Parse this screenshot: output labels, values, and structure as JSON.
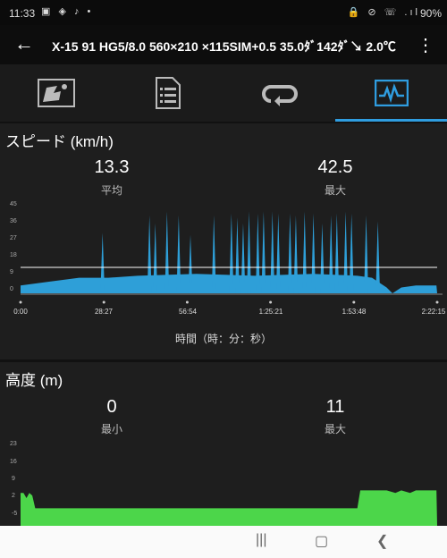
{
  "status": {
    "time": "11:33",
    "left_icons": "▣ ◈ ♪ •",
    "right_icons": "🔒 ⊘ ☏ .ıl",
    "battery": "90%"
  },
  "appbar": {
    "title": "X-15 91 HG5/8.0 560×210 ×115SIM+0.5 35.0ﾀﾞ142ﾀﾞ↘ 2.0℃"
  },
  "tabs": [
    {
      "name": "tab-map",
      "icon": "map-icon"
    },
    {
      "name": "tab-details",
      "icon": "document-icon"
    },
    {
      "name": "tab-laps",
      "icon": "loop-icon"
    },
    {
      "name": "tab-graphs",
      "icon": "graph-icon",
      "active": true
    }
  ],
  "speed": {
    "header": "スピード (km/h)",
    "avg_value": "13.3",
    "avg_label": "平均",
    "max_value": "42.5",
    "max_label": "最大",
    "y_ticks": [
      "45",
      "36",
      "27",
      "18",
      "9",
      "0"
    ],
    "x_ticks": [
      "0:00",
      "28:27",
      "56:54",
      "1:25:21",
      "1:53:48",
      "2:22:15"
    ],
    "x_axis_title": "時間（時：分：秒）",
    "line_color": "#2e9fd8"
  },
  "elevation": {
    "header": "高度 (m)",
    "min_value": "0",
    "min_label": "最小",
    "max_value": "11",
    "max_label": "最大",
    "y_ticks": [
      "23",
      "16",
      "9",
      "2",
      "-5"
    ],
    "fill_color": "#4cd64a"
  },
  "chart_data": [
    {
      "type": "area",
      "ylabel": "スピード (km/h)",
      "xlabel": "時間（時：分：秒）",
      "ylim": [
        0,
        45
      ],
      "x_range_minutes": [
        0,
        142.25
      ],
      "average": 13.3,
      "peaks_minutes": [
        [
          28,
          31
        ],
        [
          44,
          40
        ],
        [
          46,
          36
        ],
        [
          50,
          42
        ],
        [
          54,
          40
        ],
        [
          58,
          30
        ],
        [
          66,
          40
        ],
        [
          72,
          41
        ],
        [
          74,
          39
        ],
        [
          76,
          36
        ],
        [
          78,
          42
        ],
        [
          81,
          41
        ],
        [
          83,
          42
        ],
        [
          86,
          42
        ],
        [
          88,
          41
        ],
        [
          92,
          41
        ],
        [
          94,
          40
        ],
        [
          97,
          42
        ],
        [
          100,
          41
        ],
        [
          103,
          36
        ],
        [
          106,
          40
        ],
        [
          108,
          41
        ],
        [
          111,
          42
        ],
        [
          113,
          41
        ],
        [
          118,
          40
        ],
        [
          122,
          37
        ]
      ],
      "baseline_values": [
        [
          0,
          4
        ],
        [
          10,
          6
        ],
        [
          20,
          8
        ],
        [
          30,
          8
        ],
        [
          40,
          9
        ],
        [
          60,
          10
        ],
        [
          80,
          9
        ],
        [
          100,
          10
        ],
        [
          115,
          9
        ],
        [
          120,
          8
        ],
        [
          123,
          5
        ],
        [
          125,
          3
        ],
        [
          127,
          0
        ],
        [
          130,
          3
        ],
        [
          135,
          4
        ],
        [
          142,
          4
        ]
      ]
    },
    {
      "type": "area",
      "ylabel": "高度 (m)",
      "ylim": [
        -5,
        23
      ],
      "min": 0,
      "max": 11,
      "values_minutes": [
        [
          0,
          4
        ],
        [
          1,
          4
        ],
        [
          2,
          2
        ],
        [
          3,
          4
        ],
        [
          4,
          3
        ],
        [
          5,
          -2
        ],
        [
          115,
          -2
        ],
        [
          116,
          5
        ],
        [
          125,
          5
        ],
        [
          128,
          4
        ],
        [
          130,
          5
        ],
        [
          133,
          4
        ],
        [
          135,
          5
        ],
        [
          142,
          5
        ]
      ]
    }
  ]
}
